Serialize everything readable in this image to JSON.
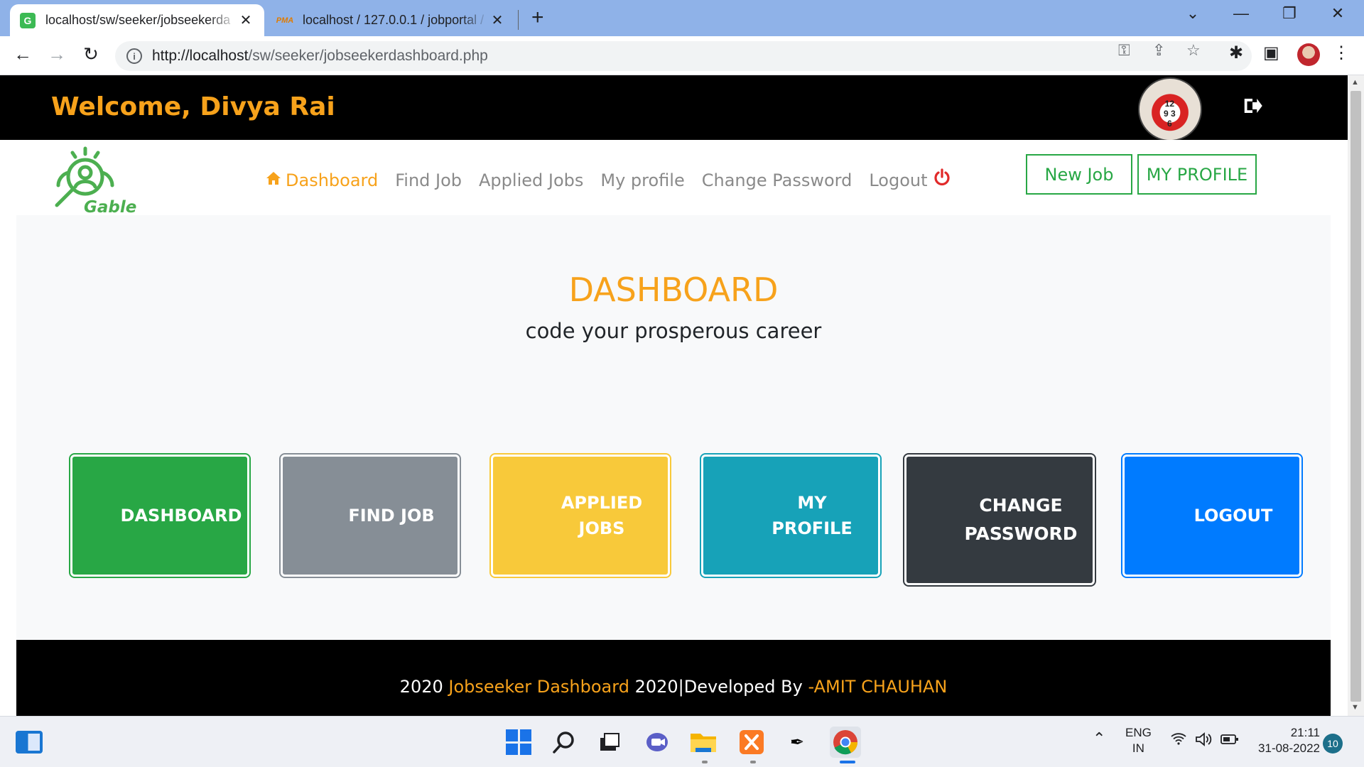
{
  "browser": {
    "tabs": [
      {
        "title": "localhost/sw/seeker/jobseekerda",
        "favicon": "G",
        "active": true,
        "close": "✕"
      },
      {
        "title": "localhost / 127.0.0.1 / jobportal /",
        "favicon": "PMA",
        "active": false,
        "close": "✕"
      }
    ],
    "new_tab": "+",
    "url_main": "http://localhost",
    "url_path": "/sw/seeker/jobseekerdashboard.php",
    "window_controls": [
      "⌄",
      "—",
      "❐",
      "✕"
    ]
  },
  "header": {
    "welcome": "Welcome, Divya Rai",
    "clock_digits": "12\n9 3\n6"
  },
  "navbar": {
    "logo_text": "Gable",
    "menu": [
      {
        "label": "Dashboard",
        "icon": "home-icon",
        "active": true
      },
      {
        "label": "Find Job"
      },
      {
        "label": "Applied Jobs"
      },
      {
        "label": "My profile"
      },
      {
        "label": "Change Password"
      },
      {
        "label": "Logout",
        "icon": "power-icon"
      }
    ],
    "new_job_button": "New Job",
    "my_profile_button": "MY PROFILE"
  },
  "main": {
    "title": "DASHBOARD",
    "subtitle": "code your prosperous career",
    "cards": [
      {
        "label": "DASHBOARD",
        "color": "#28a745"
      },
      {
        "label": "FIND JOB",
        "color": "#868e96"
      },
      {
        "label": "APPLIED JOBS",
        "line1": "APPLIED",
        "line2": "JOBS",
        "color": "#f8c93a"
      },
      {
        "label": "MY PROFILE",
        "line1": "MY",
        "line2": "PROFILE",
        "color": "#17a2b8"
      },
      {
        "label": "CHANGE PASSWORD",
        "line1": "CHANGE",
        "line2": "PASSWORD",
        "color": "#343a40"
      },
      {
        "label": "LOGOUT",
        "color": "#007bff"
      }
    ]
  },
  "footer": {
    "part1": "2020 ",
    "part2": "Jobseeker Dashboard",
    "part3": " 2020|Developed By ",
    "part4": "-AMIT CHAUHAN"
  },
  "taskbar": {
    "lang_line1": "ENG",
    "lang_line2": "IN",
    "time": "21:11",
    "date": "31-08-2022",
    "notification_count": "10"
  },
  "colors": {
    "accent": "#f7a21b",
    "green": "#28a745",
    "black": "#000000"
  }
}
